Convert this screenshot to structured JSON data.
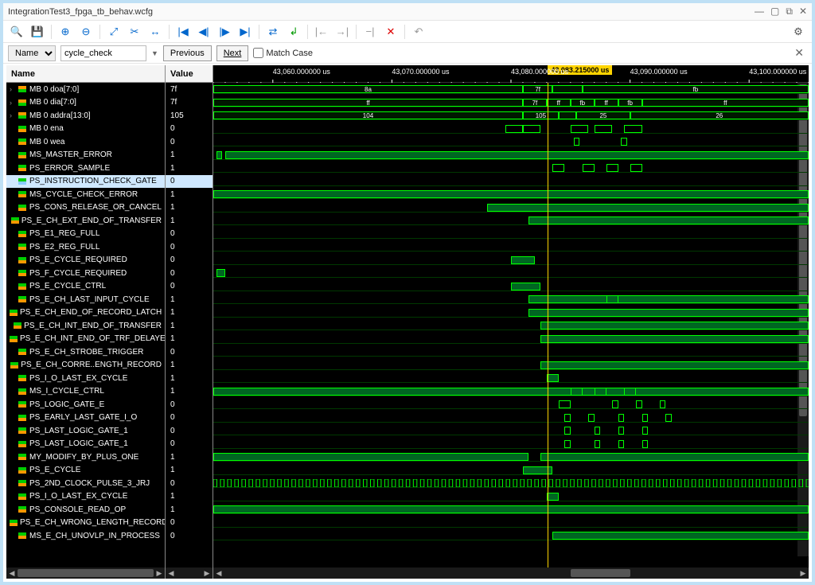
{
  "window": {
    "title": "IntegrationTest3_fpga_tb_behav.wcfg"
  },
  "search": {
    "scope_label": "Name",
    "query": "cycle_check",
    "prev": "Previous",
    "next": "Next",
    "match_case": "Match Case"
  },
  "cursor": {
    "time_label": "43,083.215000 us",
    "x_pct": 56.2
  },
  "time_ticks": [
    {
      "label": "43,060.000000 us",
      "x_pct": 10
    },
    {
      "label": "43,070.000000 us",
      "x_pct": 30
    },
    {
      "label": "43,080.000000 us",
      "x_pct": 50
    },
    {
      "label": "43,090.000000 us",
      "x_pct": 70
    },
    {
      "label": "43,100.000000 us",
      "x_pct": 90
    }
  ],
  "columns": {
    "name": "Name",
    "value": "Value"
  },
  "signals": [
    {
      "name": "MB 0 doa[7:0]",
      "value": "7f",
      "type": "bus",
      "expandable": true,
      "segments": [
        {
          "start": 0,
          "end": 52,
          "label": "8a"
        },
        {
          "start": 52,
          "end": 57,
          "label": "7f"
        },
        {
          "start": 57,
          "end": 62,
          "label": ""
        },
        {
          "start": 62,
          "end": 100,
          "label": "fb"
        }
      ]
    },
    {
      "name": "MB 0 dia[7:0]",
      "value": "7f",
      "type": "bus",
      "expandable": true,
      "segments": [
        {
          "start": 0,
          "end": 52,
          "label": "ff"
        },
        {
          "start": 52,
          "end": 56,
          "label": "7f"
        },
        {
          "start": 56,
          "end": 60,
          "label": "ff"
        },
        {
          "start": 60,
          "end": 64,
          "label": "fb"
        },
        {
          "start": 64,
          "end": 68,
          "label": "ff"
        },
        {
          "start": 68,
          "end": 72,
          "label": "fb"
        },
        {
          "start": 72,
          "end": 100,
          "label": "ff"
        }
      ]
    },
    {
      "name": "MB 0 addra[13:0]",
      "value": "105",
      "type": "bus",
      "expandable": true,
      "segments": [
        {
          "start": 0,
          "end": 52,
          "label": "104"
        },
        {
          "start": 52,
          "end": 58,
          "label": "105"
        },
        {
          "start": 58,
          "end": 61,
          "label": ""
        },
        {
          "start": 61,
          "end": 70,
          "label": "25"
        },
        {
          "start": 70,
          "end": 100,
          "label": "26"
        }
      ]
    },
    {
      "name": "MB 0 ena",
      "value": "0",
      "type": "sig",
      "pulses": [
        {
          "at": 49,
          "w": 3
        },
        {
          "at": 52,
          "w": 3
        },
        {
          "at": 60,
          "w": 3
        },
        {
          "at": 64,
          "w": 3
        },
        {
          "at": 69,
          "w": 3
        }
      ]
    },
    {
      "name": "MB 0 wea",
      "value": "0",
      "type": "sig",
      "pulses": [
        {
          "at": 60.5,
          "w": 1
        },
        {
          "at": 68.5,
          "w": 1
        }
      ]
    },
    {
      "name": "MS_MASTER_ERROR",
      "value": "1",
      "type": "sig",
      "high": [
        {
          "start": 0.5,
          "end": 1.5
        },
        {
          "start": 2,
          "end": 100
        }
      ]
    },
    {
      "name": "PS_ERROR_SAMPLE",
      "value": "1",
      "type": "sig",
      "pulses": [
        {
          "at": 57,
          "w": 2
        },
        {
          "at": 62,
          "w": 2
        },
        {
          "at": 66,
          "w": 2
        },
        {
          "at": 70,
          "w": 2
        }
      ]
    },
    {
      "name": "PS_INSTRUCTION_CHECK_GATE",
      "value": "0",
      "type": "sig",
      "selected": true,
      "high": []
    },
    {
      "name": "MS_CYCLE_CHECK_ERROR",
      "value": "1",
      "type": "sig",
      "high": [
        {
          "start": 0,
          "end": 100
        }
      ]
    },
    {
      "name": "PS_CONS_RELEASE_OR_CANCEL",
      "value": "1",
      "type": "sig",
      "high": [
        {
          "start": 46,
          "end": 100
        }
      ]
    },
    {
      "name": "PS_E_CH_EXT_END_OF_TRANSFER",
      "value": "1",
      "type": "sig",
      "high": [
        {
          "start": 53,
          "end": 100
        }
      ]
    },
    {
      "name": "PS_E1_REG_FULL",
      "value": "0",
      "type": "sig",
      "high": []
    },
    {
      "name": "PS_E2_REG_FULL",
      "value": "0",
      "type": "sig",
      "high": []
    },
    {
      "name": "PS_E_CYCLE_REQUIRED",
      "value": "0",
      "type": "sig",
      "high": [
        {
          "start": 50,
          "end": 54
        }
      ]
    },
    {
      "name": "PS_F_CYCLE_REQUIRED",
      "value": "0",
      "type": "sig",
      "high": [
        {
          "start": 0.5,
          "end": 2
        }
      ]
    },
    {
      "name": "PS_E_CYCLE_CTRL",
      "value": "0",
      "type": "sig",
      "high": [
        {
          "start": 50,
          "end": 55
        }
      ]
    },
    {
      "name": "PS_E_CH_LAST_INPUT_CYCLE",
      "value": "1",
      "type": "sig",
      "high": [
        {
          "start": 53,
          "end": 100
        }
      ],
      "pulses": [
        {
          "at": 66,
          "w": 2
        }
      ]
    },
    {
      "name": "PS_E_CH_END_OF_RECORD_LATCH",
      "value": "1",
      "type": "sig",
      "high": [
        {
          "start": 53,
          "end": 100
        }
      ]
    },
    {
      "name": "PS_E_CH_INT_END_OF_TRANSFER",
      "value": "1",
      "type": "sig",
      "high": [
        {
          "start": 55,
          "end": 100
        }
      ]
    },
    {
      "name": "PS_E_CH_INT_END_OF_TRF_DELAYED",
      "value": "1",
      "type": "sig",
      "high": [
        {
          "start": 55,
          "end": 100
        }
      ]
    },
    {
      "name": "PS_E_CH_STROBE_TRIGGER",
      "value": "0",
      "type": "sig",
      "high": []
    },
    {
      "name": "PS_E_CH_CORRE..ENGTH_RECORD",
      "value": "1",
      "type": "sig",
      "high": [
        {
          "start": 55,
          "end": 100
        }
      ]
    },
    {
      "name": "PS_I_O_LAST_EX_CYCLE",
      "value": "1",
      "type": "sig",
      "high": [
        {
          "start": 56,
          "end": 58
        }
      ]
    },
    {
      "name": "MS_I_CYCLE_CTRL",
      "value": "1",
      "type": "sig",
      "high": [
        {
          "start": 0,
          "end": 100
        }
      ],
      "pulses": [
        {
          "at": 60,
          "w": 2
        },
        {
          "at": 64,
          "w": 2
        },
        {
          "at": 69,
          "w": 2
        }
      ]
    },
    {
      "name": "PS_LOGIC_GATE_E",
      "value": "0",
      "type": "sig",
      "pulses": [
        {
          "at": 58,
          "w": 2
        },
        {
          "at": 67,
          "w": 1
        },
        {
          "at": 71,
          "w": 1
        },
        {
          "at": 75,
          "w": 1
        }
      ]
    },
    {
      "name": "PS_EARLY_LAST_GATE_I_O",
      "value": "0",
      "type": "sig",
      "pulses": [
        {
          "at": 59,
          "w": 1
        },
        {
          "at": 63,
          "w": 1
        },
        {
          "at": 68,
          "w": 1
        },
        {
          "at": 72,
          "w": 1
        },
        {
          "at": 76,
          "w": 1
        }
      ]
    },
    {
      "name": "PS_LAST_LOGIC_GATE_1",
      "value": "0",
      "type": "sig",
      "pulses": [
        {
          "at": 59,
          "w": 1
        },
        {
          "at": 64,
          "w": 1
        },
        {
          "at": 68,
          "w": 1
        },
        {
          "at": 72,
          "w": 1
        }
      ]
    },
    {
      "name": "PS_LAST_LOGIC_GATE_1",
      "value": "0",
      "type": "sig",
      "pulses": [
        {
          "at": 59,
          "w": 1
        },
        {
          "at": 64,
          "w": 1
        },
        {
          "at": 68,
          "w": 1
        },
        {
          "at": 72,
          "w": 1
        }
      ]
    },
    {
      "name": "MY_MODIFY_BY_PLUS_ONE",
      "value": "1",
      "type": "sig",
      "high": [
        {
          "start": 0,
          "end": 53
        },
        {
          "start": 55,
          "end": 100
        }
      ]
    },
    {
      "name": "PS_E_CYCLE",
      "value": "1",
      "type": "sig",
      "high": [
        {
          "start": 52,
          "end": 57
        }
      ]
    },
    {
      "name": "PS_2ND_CLOCK_PULSE_3_JRJ",
      "value": "0",
      "type": "clock"
    },
    {
      "name": "PS_I_O_LAST_EX_CYCLE",
      "value": "1",
      "type": "sig",
      "high": [
        {
          "start": 56,
          "end": 58
        }
      ]
    },
    {
      "name": "PS_CONSOLE_READ_OP",
      "value": "1",
      "type": "sig",
      "high": [
        {
          "start": 0,
          "end": 100
        }
      ]
    },
    {
      "name": "PS_E_CH_WRONG_LENGTH_RECORD",
      "value": "0",
      "type": "sig",
      "high": []
    },
    {
      "name": "MS_E_CH_UNOVLP_IN_PROCESS",
      "value": "0",
      "type": "sig",
      "high": [
        {
          "start": 57,
          "end": 100
        }
      ]
    }
  ]
}
